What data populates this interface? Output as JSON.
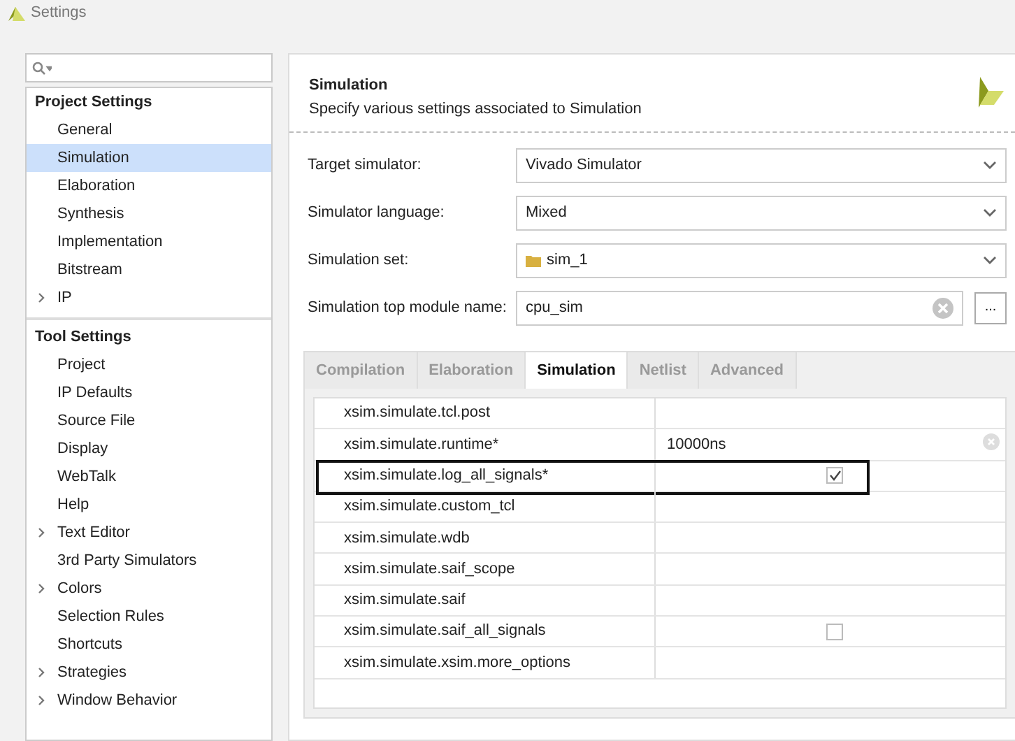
{
  "window": {
    "title": "Settings"
  },
  "sidebar": {
    "groups": [
      {
        "title": "Project Settings",
        "items": [
          {
            "label": "General",
            "selected": false,
            "expandable": false
          },
          {
            "label": "Simulation",
            "selected": true,
            "expandable": false
          },
          {
            "label": "Elaboration",
            "selected": false,
            "expandable": false
          },
          {
            "label": "Synthesis",
            "selected": false,
            "expandable": false
          },
          {
            "label": "Implementation",
            "selected": false,
            "expandable": false
          },
          {
            "label": "Bitstream",
            "selected": false,
            "expandable": false
          },
          {
            "label": "IP",
            "selected": false,
            "expandable": true
          }
        ]
      },
      {
        "title": "Tool Settings",
        "items": [
          {
            "label": "Project",
            "selected": false,
            "expandable": false
          },
          {
            "label": "IP Defaults",
            "selected": false,
            "expandable": false
          },
          {
            "label": "Source File",
            "selected": false,
            "expandable": false
          },
          {
            "label": "Display",
            "selected": false,
            "expandable": false
          },
          {
            "label": "WebTalk",
            "selected": false,
            "expandable": false
          },
          {
            "label": "Help",
            "selected": false,
            "expandable": false
          },
          {
            "label": "Text Editor",
            "selected": false,
            "expandable": true
          },
          {
            "label": "3rd Party Simulators",
            "selected": false,
            "expandable": false
          },
          {
            "label": "Colors",
            "selected": false,
            "expandable": true
          },
          {
            "label": "Selection Rules",
            "selected": false,
            "expandable": false
          },
          {
            "label": "Shortcuts",
            "selected": false,
            "expandable": false
          },
          {
            "label": "Strategies",
            "selected": false,
            "expandable": true
          },
          {
            "label": "Window Behavior",
            "selected": false,
            "expandable": true
          }
        ]
      }
    ]
  },
  "panel": {
    "title": "Simulation",
    "subtitle": "Specify various settings associated to Simulation",
    "fields": [
      {
        "label": "Target simulator:",
        "kind": "select",
        "value": "Vivado Simulator"
      },
      {
        "label": "Simulator language:",
        "kind": "select",
        "value": "Mixed"
      },
      {
        "label": "Simulation set:",
        "kind": "set-select",
        "value": "sim_1"
      },
      {
        "label": "Simulation top module name:",
        "kind": "text",
        "value": "cpu_sim",
        "browse": "..."
      }
    ],
    "tabs": [
      {
        "label": "Compilation",
        "selected": false
      },
      {
        "label": "Elaboration",
        "selected": false
      },
      {
        "label": "Simulation",
        "selected": true
      },
      {
        "label": "Netlist",
        "selected": false
      },
      {
        "label": "Advanced",
        "selected": false
      }
    ],
    "options": [
      {
        "name": "xsim.simulate.tcl.post",
        "kind": "blank",
        "highlighted": false
      },
      {
        "name": "xsim.simulate.runtime*",
        "kind": "text",
        "value": "10000ns",
        "highlighted": false
      },
      {
        "name": "xsim.simulate.log_all_signals*",
        "kind": "checkbox",
        "checked": true,
        "highlighted": true
      },
      {
        "name": "xsim.simulate.custom_tcl",
        "kind": "blank",
        "highlighted": false
      },
      {
        "name": "xsim.simulate.wdb",
        "kind": "blank",
        "highlighted": false
      },
      {
        "name": "xsim.simulate.saif_scope",
        "kind": "blank",
        "highlighted": false
      },
      {
        "name": "xsim.simulate.saif",
        "kind": "blank",
        "highlighted": false
      },
      {
        "name": "xsim.simulate.saif_all_signals",
        "kind": "checkbox",
        "checked": false,
        "highlighted": false
      },
      {
        "name": "xsim.simulate.xsim.more_options",
        "kind": "blank",
        "highlighted": false
      }
    ]
  }
}
